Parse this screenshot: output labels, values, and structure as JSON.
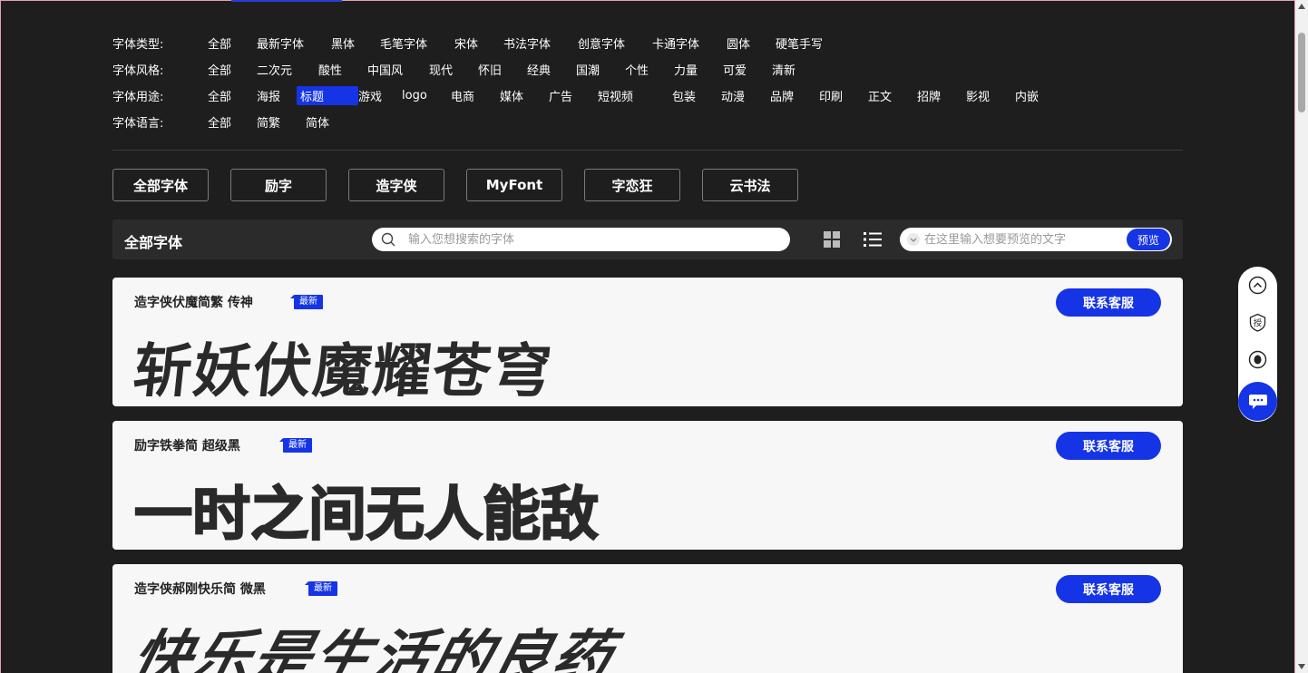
{
  "filters": [
    {
      "label": "字体类型:",
      "options": [
        "全部",
        "最新字体",
        "黑体",
        "毛笔字体",
        "宋体",
        "书法字体",
        "创意字体",
        "卡通字体",
        "圆体",
        "硬笔手写"
      ],
      "active": -1
    },
    {
      "label": "字体风格:",
      "options": [
        "全部",
        "二次元",
        "酸性",
        "中国风",
        "现代",
        "怀旧",
        "经典",
        "国潮",
        "个性",
        "力量",
        "可爱",
        "清新"
      ],
      "active": -1
    },
    {
      "label": "字体用途:",
      "options": [
        "全部",
        "海报",
        "标题",
        "游戏",
        "logo",
        "电商",
        "媒体",
        "广告",
        "短视频",
        "包装",
        "动漫",
        "品牌",
        "印刷",
        "正文",
        "招牌",
        "影视",
        "内嵌"
      ],
      "active": 2
    },
    {
      "label": "字体语言:",
      "options": [
        "全部",
        "简繁",
        "简体"
      ],
      "active": -1
    }
  ],
  "source_tabs": [
    "全部字体",
    "励字",
    "造字侠",
    "MyFont",
    "字恋狂",
    "云书法"
  ],
  "toolbar": {
    "title": "全部字体",
    "search_placeholder": "输入您想搜索的字体",
    "preview_placeholder": "在这里输入想要预览的文字",
    "preview_button": "预览"
  },
  "cards": [
    {
      "name": "造字侠伏魔简繁 传神",
      "badge": "最新",
      "contact": "联系客服",
      "preview": "斩妖伏魔耀苍穹"
    },
    {
      "name": "励字铁拳简 超级黑",
      "badge": "最新",
      "contact": "联系客服",
      "preview": "一时之间无人能敌"
    },
    {
      "name": "造字侠郝刚快乐简 微黑",
      "badge": "最新",
      "contact": "联系客服",
      "preview": "快乐是生活的良药"
    }
  ],
  "float_panel": {
    "items": [
      "scroll-top-icon",
      "authorize-icon",
      "qq-icon",
      "chat-icon"
    ],
    "authorize_label": "授"
  },
  "colors": {
    "accent": "#1534e6",
    "background": "#1e1e1e",
    "card": "#f7f7f7"
  }
}
